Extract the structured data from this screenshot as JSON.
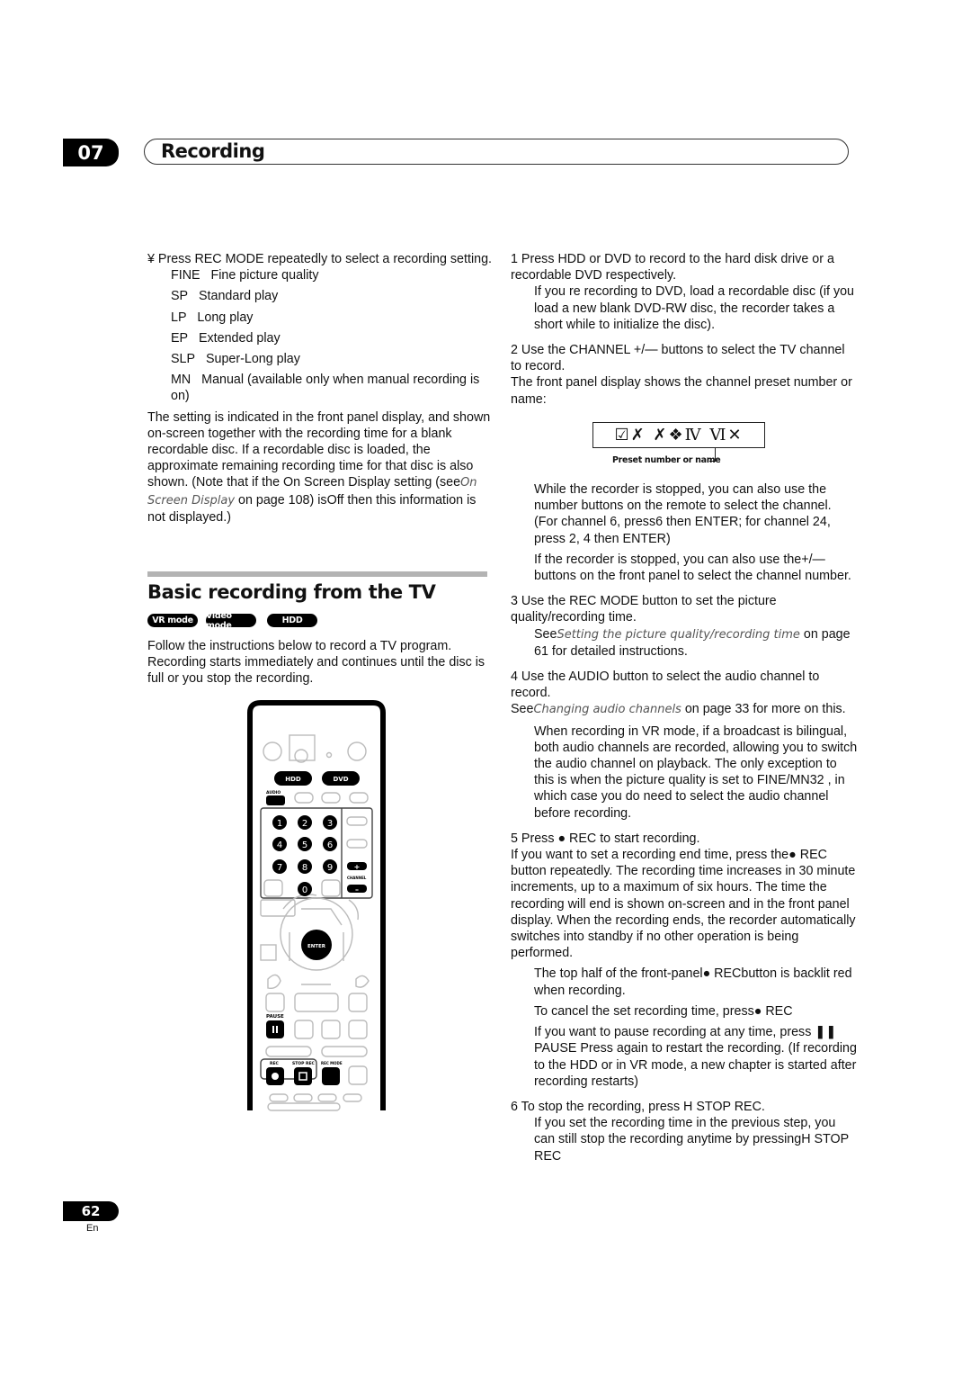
{
  "header": {
    "chapter_number": "07",
    "chapter_title": "Recording"
  },
  "left_column": {
    "step_intro": "¥   Press REC MODE repeatedly to select a recording setting.",
    "modes": [
      {
        "code": "FINE",
        "label": "Fine picture quality"
      },
      {
        "code": "SP",
        "label": "Standard play"
      },
      {
        "code": "LP",
        "label": "Long play"
      },
      {
        "code": "EP",
        "label": "Extended play"
      },
      {
        "code": "SLP",
        "label": "Super-Long play"
      },
      {
        "code": "MN",
        "label": "Manual (available only when manual recording is on)"
      }
    ],
    "note_part1": "The setting is indicated in the front panel display, and shown on-screen together with the recording time for a blank recordable disc. If a recordable disc is loaded, the approximate remaining recording time for that disc is also shown. (Note that if the On Screen Display setting (see",
    "note_link": "On Screen Display",
    "note_part2": " on page 108) is",
    "note_off": "Off",
    "note_part3": "  then this information is not displayed.)"
  },
  "section": {
    "title": "Basic recording from the TV",
    "badges": [
      "VR mode",
      "Video mode",
      "HDD"
    ],
    "intro": "Follow the instructions below to record a TV program. Recording starts immediately and continues until the disc is full or you stop the recording."
  },
  "remote": {
    "hdd": "HDD",
    "dvd": "DVD",
    "audio": "AUDIO",
    "numbers": [
      "1",
      "2",
      "3",
      "4",
      "5",
      "6",
      "7",
      "8",
      "9",
      "0"
    ],
    "channel": "CHANNEL",
    "plus": "+",
    "minus": "–",
    "enter": "ENTER",
    "pause": "PAUSE",
    "rec": "REC",
    "stop_rec": "STOP REC",
    "rec_mode": "REC MODE"
  },
  "right_column": {
    "step1_title": "1    Press HDD or DVD to record to the hard disk drive or a recordable DVD respectively.",
    "step1_note": "If you re recording to DVD, load a recordable disc (if you load a new blank DVD-RW disc, the recorder takes a short while to initialize the disc).",
    "step2_title": "2    Use the CHANNEL +/— buttons to select the TV channel to record.",
    "step2_body": "The front panel display shows the channel preset number or name:",
    "display_text": "☑✗ ✗❖Ⅳ Ⅵ✕",
    "display_caption": "Preset number or name",
    "step2_note1": "While the recorder is stopped, you can also use the number buttons on the remote to select the channel. (For channel 6, press6 then ENTER; for channel 24, press 2, 4 then ENTER)",
    "step2_note2": "If the recorder is stopped, you can also use the+/— buttons on the front panel to select the channel number.",
    "step3_title": "3    Use the REC MODE button to set the picture quality/recording time.",
    "step3_see": "See",
    "step3_link": "Setting the picture quality/recording time",
    "step3_rest": " on page 61 for detailed instructions.",
    "step4_title": "4    Use the AUDIO button to select the audio channel to record.",
    "step4_see": "See",
    "step4_link": "Changing audio channels",
    "step4_rest": " on page 33 for more on this.",
    "step4_note": "When recording in VR mode, if a broadcast is bilingual, both audio channels are recorded, allowing you to switch the audio channel on playback. The only exception to this is when the picture quality is set to FINE/MN32 , in which case you do need to select the audio channel before recording.",
    "step5_title": "5    Press ● REC to start recording.",
    "step5_body": "If you want to set a recording end time, press the● REC button repeatedly. The recording time increases in 30 minute increments, up to a maximum of six hours. The time the recording will end is shown on-screen and in the front panel display. When the recording ends, the recorder automatically switches into standby if no other operation is being performed.",
    "step5_note1": "The top half of the front-panel● RECbutton is backlit red when recording.",
    "step5_note2": "To cancel the set recording time, press● REC",
    "step5_note3": "If you want to pause recording at any time, press ❚❚ PAUSE Press again to restart the recording. (If recording to the HDD or in VR mode, a new chapter is started after recording restarts)",
    "step6_title": "6    To stop the recording, press    H  STOP REC.",
    "step6_body": "If you set the recording time in the previous step, you can still stop the recording anytime by pressingH STOP REC"
  },
  "footer": {
    "page_number": "62",
    "language": "En"
  }
}
